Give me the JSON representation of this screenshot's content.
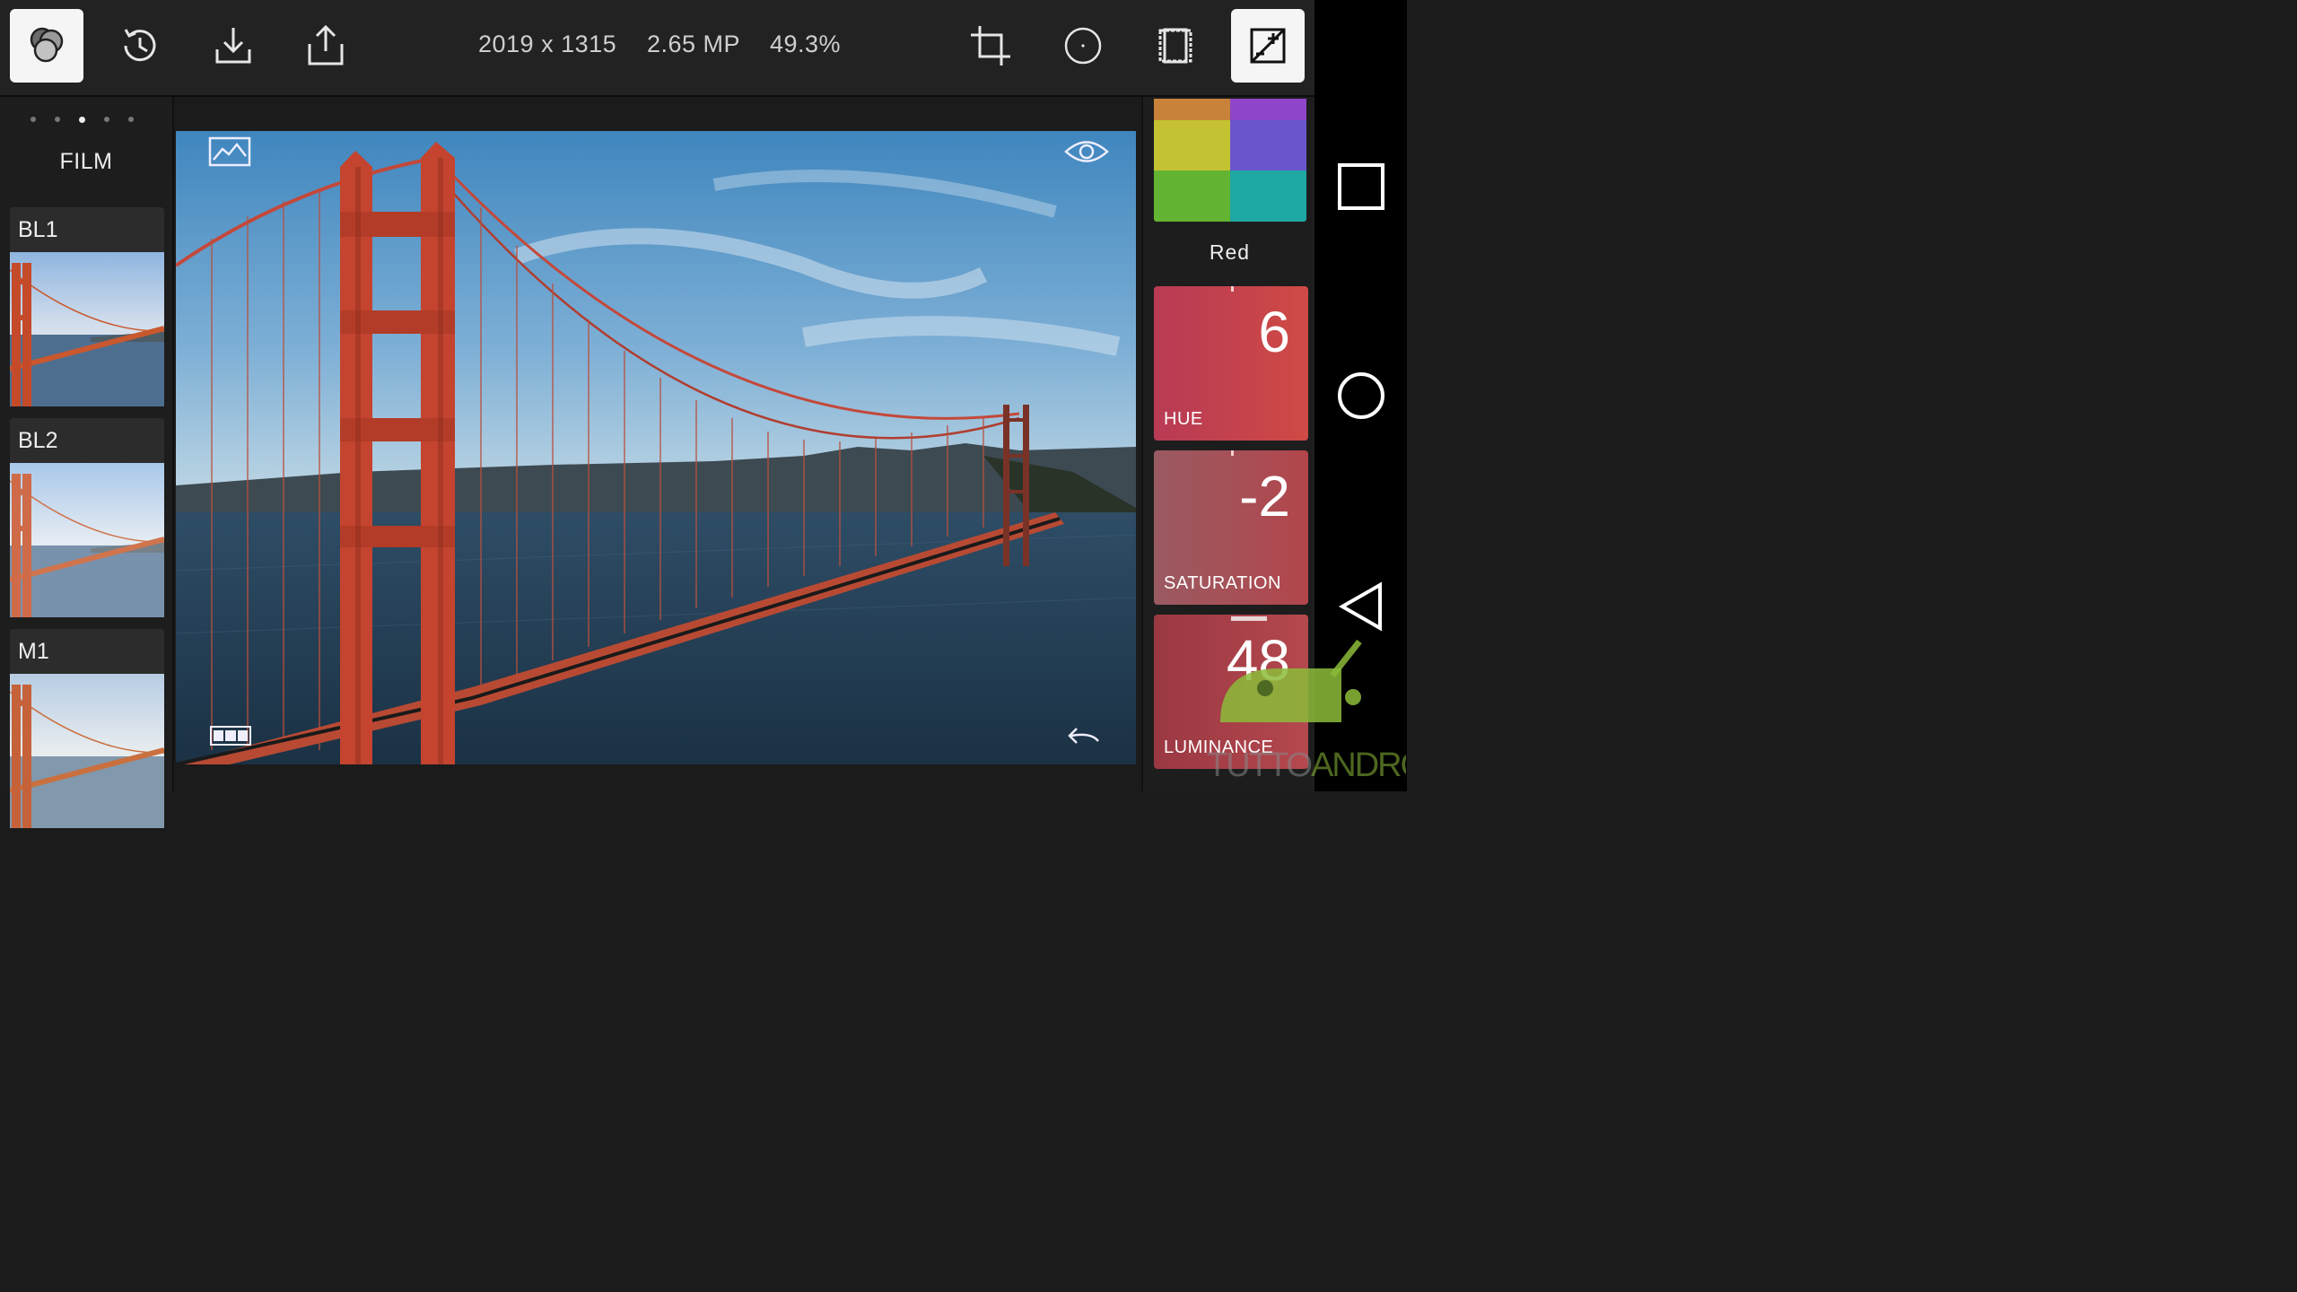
{
  "toolbar": {
    "width_height": "2019 x 1315",
    "megapixels": "2.65 MP",
    "zoom": "49.3%"
  },
  "film_panel": {
    "page_count": 5,
    "active_page_index": 2,
    "category": "FILM",
    "presets": [
      {
        "label": "BL1"
      },
      {
        "label": "BL2"
      },
      {
        "label": "M1"
      }
    ]
  },
  "hsl_panel": {
    "swatch_colors": [
      "#c8823a",
      "#8f45c8",
      "#c4c232",
      "#6a55cc",
      "#62b432",
      "#1ea8a4"
    ],
    "selected_color": "Red",
    "hue": {
      "label": "HUE",
      "value": "6",
      "color": "#c9424f"
    },
    "saturation": {
      "label": "SATURATION",
      "value": "-2",
      "color": "#a94f55"
    },
    "luminance": {
      "label": "LUMINANCE",
      "value": "48",
      "color": "#aa3c45"
    }
  },
  "watermark": "TUTTOANDROID"
}
